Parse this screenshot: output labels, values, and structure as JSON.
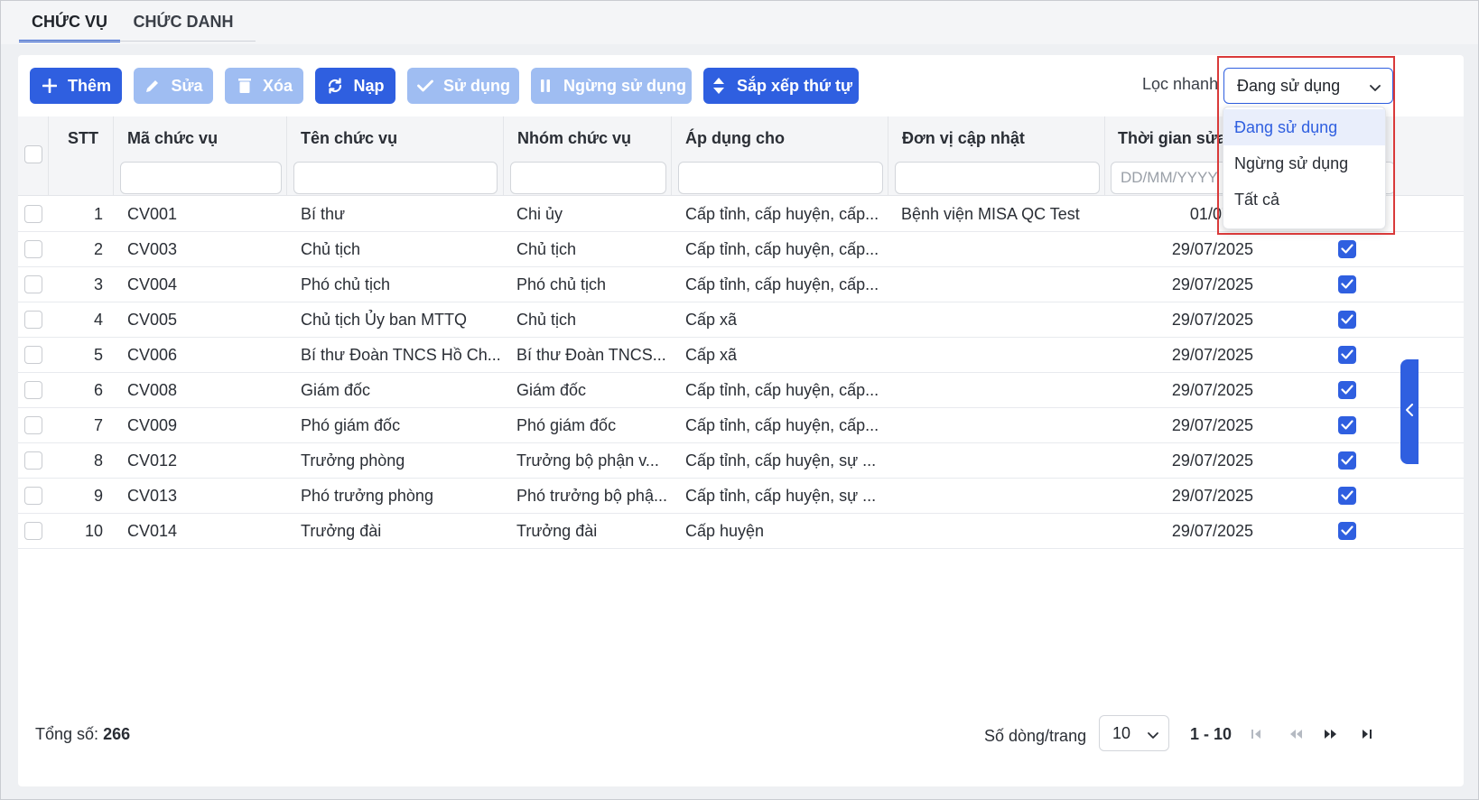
{
  "tabs": [
    {
      "label": "CHỨC VỤ",
      "active": true
    },
    {
      "label": "CHỨC DANH",
      "active": false
    }
  ],
  "toolbar": {
    "add": "Thêm",
    "edit": "Sửa",
    "delete": "Xóa",
    "reload": "Nạp",
    "use": "Sử dụng",
    "stop_use": "Ngừng sử dụng",
    "sort": "Sắp xếp thứ tự"
  },
  "filter": {
    "label": "Lọc nhanh",
    "selected": "Đang sử dụng",
    "options": [
      "Đang sử dụng",
      "Ngừng sử dụng",
      "Tất cả"
    ]
  },
  "columns": {
    "stt": "STT",
    "code": "Mã chức vụ",
    "name": "Tên chức vụ",
    "group": "Nhóm chức vụ",
    "apply": "Áp dụng cho",
    "unit": "Đơn vị cập nhật",
    "time": "Thời gian sửa g",
    "time_placeholder": "DD/MM/YYYY"
  },
  "rows": [
    {
      "stt": "1",
      "code": "CV001",
      "name": "Bí thư",
      "group": "Chi ủy",
      "apply": "Cấp tỉnh, cấp huyện, cấp...",
      "unit": "Bệnh viện MISA QC Test",
      "time": "01/07/20",
      "active": false
    },
    {
      "stt": "2",
      "code": "CV003",
      "name": "Chủ tịch",
      "group": "Chủ tịch",
      "apply": "Cấp tỉnh, cấp huyện, cấp...",
      "unit": "",
      "time": "29/07/2025",
      "active": true
    },
    {
      "stt": "3",
      "code": "CV004",
      "name": "Phó chủ tịch",
      "group": "Phó chủ tịch",
      "apply": "Cấp tỉnh, cấp huyện, cấp...",
      "unit": "",
      "time": "29/07/2025",
      "active": true
    },
    {
      "stt": "4",
      "code": "CV005",
      "name": "Chủ tịch Ủy ban MTTQ",
      "group": "Chủ tịch",
      "apply": "Cấp xã",
      "unit": "",
      "time": "29/07/2025",
      "active": true
    },
    {
      "stt": "5",
      "code": "CV006",
      "name": "Bí thư Đoàn TNCS Hồ Ch...",
      "group": "Bí thư Đoàn TNCS...",
      "apply": "Cấp xã",
      "unit": "",
      "time": "29/07/2025",
      "active": true
    },
    {
      "stt": "6",
      "code": "CV008",
      "name": "Giám đốc",
      "group": "Giám đốc",
      "apply": "Cấp tỉnh, cấp huyện, cấp...",
      "unit": "",
      "time": "29/07/2025",
      "active": true
    },
    {
      "stt": "7",
      "code": "CV009",
      "name": "Phó giám đốc",
      "group": "Phó giám đốc",
      "apply": "Cấp tỉnh, cấp huyện, cấp...",
      "unit": "",
      "time": "29/07/2025",
      "active": true
    },
    {
      "stt": "8",
      "code": "CV012",
      "name": "Trưởng phòng",
      "group": "Trưởng bộ phận v...",
      "apply": "Cấp tỉnh, cấp huyện, sự ...",
      "unit": "",
      "time": "29/07/2025",
      "active": true
    },
    {
      "stt": "9",
      "code": "CV013",
      "name": "Phó trưởng phòng",
      "group": "Phó trưởng bộ phậ...",
      "apply": "Cấp tỉnh, cấp huyện, sự ...",
      "unit": "",
      "time": "29/07/2025",
      "active": true
    },
    {
      "stt": "10",
      "code": "CV014",
      "name": "Trưởng đài",
      "group": "Trưởng đài",
      "apply": "Cấp huyện",
      "unit": "",
      "time": "29/07/2025",
      "active": true
    }
  ],
  "footer": {
    "total_label": "Tổng số:",
    "total": "266",
    "rows_label": "Số dòng/trang",
    "page_size": "10",
    "range": "1 - 10"
  },
  "colors": {
    "primary": "#2f5fe0",
    "disabled": "#9fbdf2",
    "highlight": "#d93a3a"
  }
}
